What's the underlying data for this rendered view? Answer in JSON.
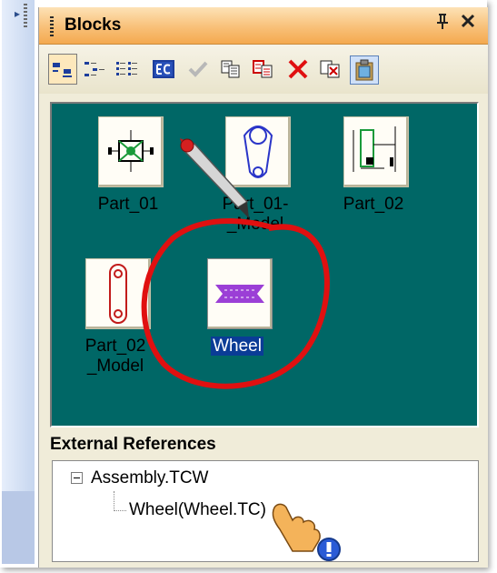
{
  "panel": {
    "title": "Blocks",
    "pin_glyph": "ᴩ",
    "close_glyph": "×"
  },
  "toolbar": {
    "buttons": [
      {
        "name": "view-large-icons-button",
        "icon": "large-icons-icon",
        "state": "pressed"
      },
      {
        "name": "view-small-icons-button",
        "icon": "small-icons-icon"
      },
      {
        "name": "view-list-button",
        "icon": "list-icon"
      },
      {
        "name": "edit-components-button",
        "icon": "ec-icon",
        "text": "EC"
      },
      {
        "name": "accept-button",
        "icon": "check-icon"
      },
      {
        "name": "copy-block-button",
        "icon": "copy-icon"
      },
      {
        "name": "replace-block-button",
        "icon": "replace-icon"
      },
      {
        "name": "delete-block-button",
        "icon": "delete-icon"
      },
      {
        "name": "explode-block-button",
        "icon": "explode-icon"
      },
      {
        "name": "paste-block-button",
        "icon": "clipboard-icon",
        "state": "active"
      }
    ]
  },
  "blocks": [
    {
      "label": "Part_01",
      "icon": "part-schematic-icon"
    },
    {
      "label": "Part_01-\n_Model",
      "icon": "rotor-arm-icon"
    },
    {
      "label": "Part_02",
      "icon": "part-drawing-icon"
    },
    {
      "label": "Part_02\n_Model",
      "icon": "link-bar-icon"
    },
    {
      "label": "Wheel",
      "icon": "wheel-block-icon",
      "selected": true
    }
  ],
  "external_references": {
    "header": "External References",
    "root": "Assembly.TCW",
    "child": "Wheel(Wheel.TC)"
  },
  "colors": {
    "title_bar": "#f8c078",
    "blocks_background": "#006766",
    "selection": "#0a3c96",
    "annotation_circle": "#e01010"
  }
}
